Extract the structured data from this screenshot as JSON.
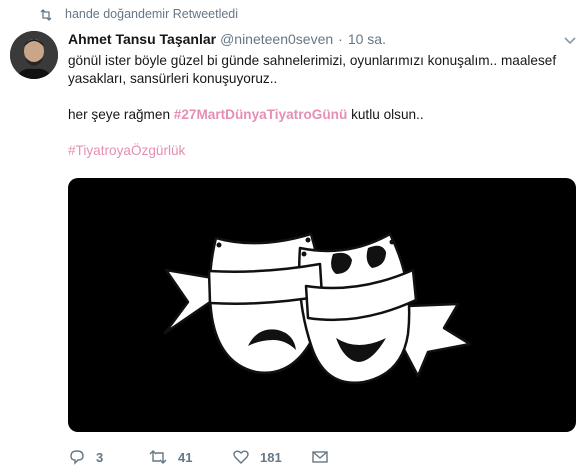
{
  "retweet": {
    "text": "hande doğandemir Retweetledi",
    "icon": "retweet-icon"
  },
  "tweet": {
    "author_name": "Ahmet Tansu Taşanlar",
    "handle": "@nineteen0seven",
    "separator": "·",
    "time": "10 sa.",
    "line1": "gönül ister böyle güzel bi günde sahnelerimizi, oyunlarımızı konuşalım.. maalesef yasakları, sansürleri konuşuyoruz..",
    "line2_prefix": "her şeye rağmen ",
    "line2_hashtag": "#27MartDünyaTiyatroGünü",
    "line2_suffix": " kutlu olsun..",
    "hashtag2": "#TiyatroyaÖzgürlük"
  },
  "actions": {
    "reply_count": "3",
    "retweet_count": "41",
    "like_count": "181"
  },
  "icons": {
    "reply": "reply-icon",
    "retweet": "retweet-icon",
    "like": "heart-icon",
    "message": "envelope-icon",
    "menu": "chevron-down-icon"
  },
  "colors": {
    "hashtag": "#e48fb3",
    "muted": "#657786",
    "text": "#14171a",
    "media_background": "#000000"
  }
}
